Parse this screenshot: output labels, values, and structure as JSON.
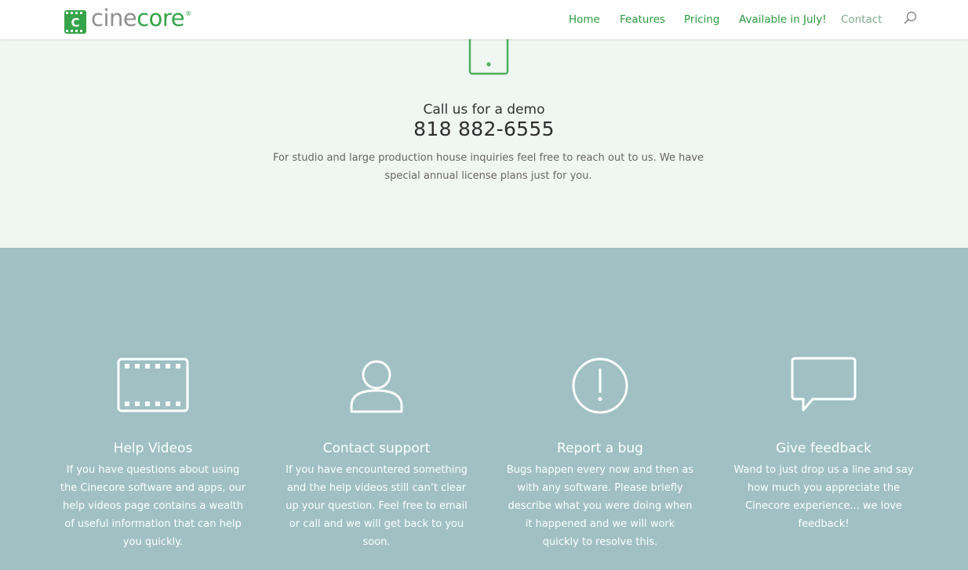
{
  "brand": {
    "name_part1": "cine",
    "name_part2": "core",
    "registered": "®",
    "mark_letter": "C"
  },
  "nav": {
    "items": [
      {
        "label": "Home"
      },
      {
        "label": "Features"
      },
      {
        "label": "Pricing"
      },
      {
        "label": "Available in July!"
      },
      {
        "label": "Contact"
      }
    ],
    "search_icon": "search-icon"
  },
  "demo": {
    "icon": "phone-icon",
    "title": "Call us for a demo",
    "phone": "818 882-6555",
    "description": "For studio and large production house inquiries feel free to reach out to us. We have special annual license plans just for you."
  },
  "support": {
    "cards": [
      {
        "icon": "film-strip-icon",
        "title": "Help Videos",
        "description": "If you have questions about using the Cinecore software and apps, our help videos page contains a wealth of useful information that can help you quickly."
      },
      {
        "icon": "user-icon",
        "title": "Contact support",
        "description": "If you have encountered something and the help videos still can’t clear up your question. Feel free to email or call and we will get back to you soon."
      },
      {
        "icon": "alert-circle-icon",
        "title": "Report a bug",
        "description": "Bugs happen every now and then as with any software. Please briefly describe what you were doing when it happened and we will work quickly to resolve this."
      },
      {
        "icon": "speech-bubble-icon",
        "title": "Give feedback",
        "description": "Wand to just drop us a line and say how much you appreciate the Cinecore experience... we love feedback!"
      }
    ]
  },
  "colors": {
    "brand_green": "#36a44a",
    "nav_green": "#2a9a3c",
    "demo_bg": "#f0f6f2",
    "support_bg": "#a0c0c3"
  }
}
